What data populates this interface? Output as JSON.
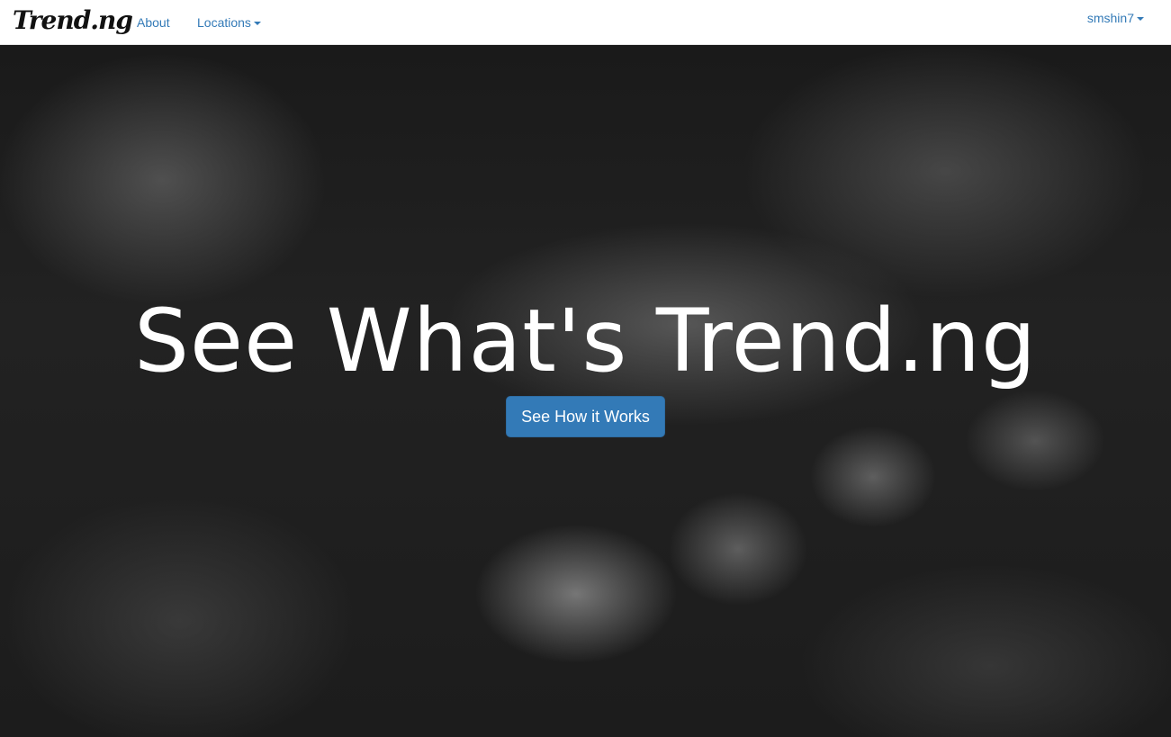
{
  "navbar": {
    "brand": "Trend.ng",
    "about_label": "About",
    "locations_label": "Locations",
    "user_label": "smshin7"
  },
  "hero": {
    "title": "See What's Trend.ng",
    "button_label": "See How it Works"
  },
  "colors": {
    "link": "#337ab7",
    "button": "#337ab7",
    "hero_text": "#ffffff"
  }
}
